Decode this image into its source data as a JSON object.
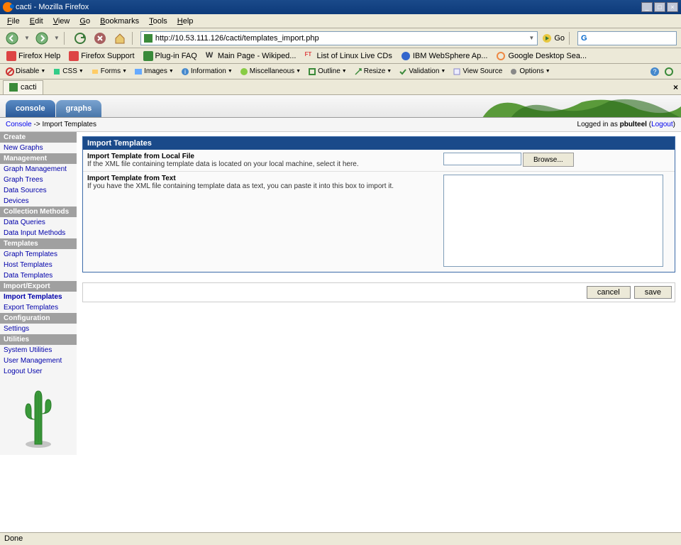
{
  "window": {
    "title": "cacti - Mozilla Firefox"
  },
  "menu": {
    "file": "File",
    "edit": "Edit",
    "view": "View",
    "go": "Go",
    "bookmarks": "Bookmarks",
    "tools": "Tools",
    "help": "Help"
  },
  "nav": {
    "url": "http://10.53.111.126/cacti/templates_import.php",
    "go": "Go"
  },
  "bookmarks": [
    {
      "label": "Firefox Help"
    },
    {
      "label": "Firefox Support"
    },
    {
      "label": "Plug-in FAQ"
    },
    {
      "label": "Main Page - Wikiped..."
    },
    {
      "label": "List of Linux Live CDs"
    },
    {
      "label": "IBM WebSphere Ap..."
    },
    {
      "label": "Google Desktop Sea..."
    }
  ],
  "devtools": {
    "disable": "Disable",
    "css": "CSS",
    "forms": "Forms",
    "images": "Images",
    "information": "Information",
    "miscellaneous": "Miscellaneous",
    "outline": "Outline",
    "resize": "Resize",
    "validation": "Validation",
    "view_source": "View Source",
    "options": "Options"
  },
  "tab": {
    "label": "cacti"
  },
  "cacti": {
    "tabs": {
      "console": "console",
      "graphs": "graphs"
    },
    "breadcrumb": {
      "console": "Console",
      "sep": " -> ",
      "current": "Import Templates"
    },
    "login": {
      "prefix": "Logged in as ",
      "user": "pbulteel",
      "logout": "Logout"
    },
    "sidebar": {
      "create": "Create",
      "new_graphs": "New Graphs",
      "management": "Management",
      "graph_management": "Graph Management",
      "graph_trees": "Graph Trees",
      "data_sources": "Data Sources",
      "devices": "Devices",
      "collection_methods": "Collection Methods",
      "data_queries": "Data Queries",
      "data_input_methods": "Data Input Methods",
      "templates": "Templates",
      "graph_templates": "Graph Templates",
      "host_templates": "Host Templates",
      "data_templates": "Data Templates",
      "import_export": "Import/Export",
      "import_templates": "Import Templates",
      "export_templates": "Export Templates",
      "configuration": "Configuration",
      "settings": "Settings",
      "utilities": "Utilities",
      "system_utilities": "System Utilities",
      "user_management": "User Management",
      "logout_user": "Logout User"
    },
    "panel": {
      "title": "Import Templates",
      "local_file_label": "Import Template from Local File",
      "local_file_hint": "If the XML file containing template data is located on your local machine, select it here.",
      "browse": "Browse...",
      "text_label": "Import Template from Text",
      "text_hint": "If you have the XML file containing template data as text, you can paste it into this box to import it.",
      "cancel": "cancel",
      "save": "save"
    }
  },
  "status": "Done"
}
